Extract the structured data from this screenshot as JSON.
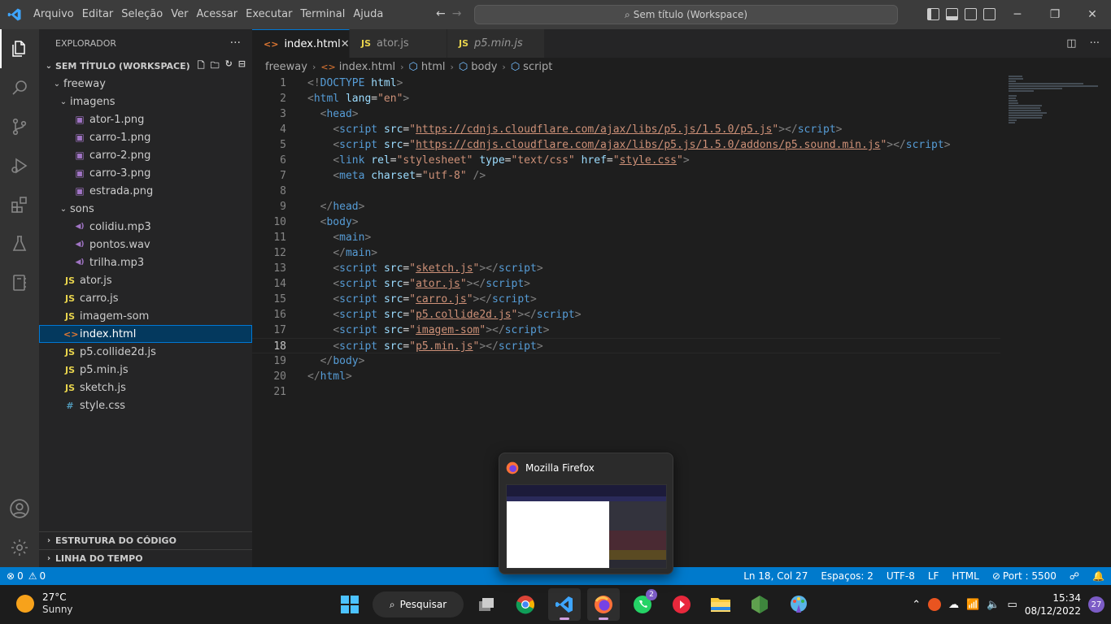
{
  "menu": [
    "Arquivo",
    "Editar",
    "Seleção",
    "Ver",
    "Acessar",
    "Executar",
    "Terminal",
    "Ajuda"
  ],
  "command_center": "Sem título (Workspace)",
  "explorer": {
    "title": "EXPLORADOR",
    "workspace": "SEM TÍTULO (WORKSPACE)",
    "tree": [
      {
        "label": "freeway",
        "type": "folder",
        "depth": 0
      },
      {
        "label": "imagens",
        "type": "folder",
        "depth": 1
      },
      {
        "label": "ator-1.png",
        "type": "img",
        "depth": 2
      },
      {
        "label": "carro-1.png",
        "type": "img",
        "depth": 2
      },
      {
        "label": "carro-2.png",
        "type": "img",
        "depth": 2
      },
      {
        "label": "carro-3.png",
        "type": "img",
        "depth": 2
      },
      {
        "label": "estrada.png",
        "type": "img",
        "depth": 2
      },
      {
        "label": "sons",
        "type": "folder",
        "depth": 1
      },
      {
        "label": "colidiu.mp3",
        "type": "snd",
        "depth": 2
      },
      {
        "label": "pontos.wav",
        "type": "snd",
        "depth": 2
      },
      {
        "label": "trilha.mp3",
        "type": "snd",
        "depth": 2
      },
      {
        "label": "ator.js",
        "type": "js",
        "depth": 1
      },
      {
        "label": "carro.js",
        "type": "js",
        "depth": 1
      },
      {
        "label": "imagem-som",
        "type": "js",
        "depth": 1
      },
      {
        "label": "index.html",
        "type": "html",
        "depth": 1,
        "selected": true
      },
      {
        "label": "p5.collide2d.js",
        "type": "js",
        "depth": 1
      },
      {
        "label": "p5.min.js",
        "type": "js",
        "depth": 1
      },
      {
        "label": "sketch.js",
        "type": "js",
        "depth": 1
      },
      {
        "label": "style.css",
        "type": "css",
        "depth": 1
      }
    ],
    "outline": "ESTRUTURA DO CÓDIGO",
    "timeline": "LINHA DO TEMPO"
  },
  "tabs": [
    {
      "label": "index.html",
      "type": "html",
      "active": true
    },
    {
      "label": "ator.js",
      "type": "js"
    },
    {
      "label": "p5.min.js",
      "type": "js",
      "italic": true
    }
  ],
  "breadcrumb": [
    "freeway",
    "index.html",
    "html",
    "body",
    "script"
  ],
  "code": [
    [
      [
        "br",
        "<!"
      ],
      [
        "tg",
        "DOCTYPE"
      ],
      [
        "tx",
        " "
      ],
      [
        "at",
        "html"
      ],
      [
        "br",
        ">"
      ]
    ],
    [
      [
        "br",
        "<"
      ],
      [
        "tg",
        "html"
      ],
      [
        "tx",
        " "
      ],
      [
        "at",
        "lang"
      ],
      [
        "tx",
        "="
      ],
      [
        "st",
        "\"en\""
      ],
      [
        "br",
        ">"
      ]
    ],
    [
      [
        "tx",
        "  "
      ],
      [
        "br",
        "<"
      ],
      [
        "tg",
        "head"
      ],
      [
        "br",
        ">"
      ]
    ],
    [
      [
        "tx",
        "    "
      ],
      [
        "br",
        "<"
      ],
      [
        "tg",
        "script"
      ],
      [
        "tx",
        " "
      ],
      [
        "at",
        "src"
      ],
      [
        "tx",
        "="
      ],
      [
        "st",
        "\""
      ],
      [
        "stu",
        "https://cdnjs.cloudflare.com/ajax/libs/p5.js/1.5.0/p5.js"
      ],
      [
        "st",
        "\""
      ],
      [
        "br",
        "></"
      ],
      [
        "tg",
        "script"
      ],
      [
        "br",
        ">"
      ]
    ],
    [
      [
        "tx",
        "    "
      ],
      [
        "br",
        "<"
      ],
      [
        "tg",
        "script"
      ],
      [
        "tx",
        " "
      ],
      [
        "at",
        "src"
      ],
      [
        "tx",
        "="
      ],
      [
        "st",
        "\""
      ],
      [
        "stu",
        "https://cdnjs.cloudflare.com/ajax/libs/p5.js/1.5.0/addons/p5.sound.min.js"
      ],
      [
        "st",
        "\""
      ],
      [
        "br",
        "></"
      ],
      [
        "tg",
        "script"
      ],
      [
        "br",
        ">"
      ]
    ],
    [
      [
        "tx",
        "    "
      ],
      [
        "br",
        "<"
      ],
      [
        "tg",
        "link"
      ],
      [
        "tx",
        " "
      ],
      [
        "at",
        "rel"
      ],
      [
        "tx",
        "="
      ],
      [
        "st",
        "\"stylesheet\""
      ],
      [
        "tx",
        " "
      ],
      [
        "at",
        "type"
      ],
      [
        "tx",
        "="
      ],
      [
        "st",
        "\"text/css\""
      ],
      [
        "tx",
        " "
      ],
      [
        "at",
        "href"
      ],
      [
        "tx",
        "="
      ],
      [
        "st",
        "\""
      ],
      [
        "stu",
        "style.css"
      ],
      [
        "st",
        "\""
      ],
      [
        "br",
        ">"
      ]
    ],
    [
      [
        "tx",
        "    "
      ],
      [
        "br",
        "<"
      ],
      [
        "tg",
        "meta"
      ],
      [
        "tx",
        " "
      ],
      [
        "at",
        "charset"
      ],
      [
        "tx",
        "="
      ],
      [
        "st",
        "\"utf-8\""
      ],
      [
        "tx",
        " "
      ],
      [
        "br",
        "/>"
      ]
    ],
    [
      [
        "tx",
        ""
      ]
    ],
    [
      [
        "tx",
        "  "
      ],
      [
        "br",
        "</"
      ],
      [
        "tg",
        "head"
      ],
      [
        "br",
        ">"
      ]
    ],
    [
      [
        "tx",
        "  "
      ],
      [
        "br",
        "<"
      ],
      [
        "tg",
        "body"
      ],
      [
        "br",
        ">"
      ]
    ],
    [
      [
        "tx",
        "    "
      ],
      [
        "br",
        "<"
      ],
      [
        "tg",
        "main"
      ],
      [
        "br",
        ">"
      ]
    ],
    [
      [
        "tx",
        "    "
      ],
      [
        "br",
        "</"
      ],
      [
        "tg",
        "main"
      ],
      [
        "br",
        ">"
      ]
    ],
    [
      [
        "tx",
        "    "
      ],
      [
        "br",
        "<"
      ],
      [
        "tg",
        "script"
      ],
      [
        "tx",
        " "
      ],
      [
        "at",
        "src"
      ],
      [
        "tx",
        "="
      ],
      [
        "st",
        "\""
      ],
      [
        "stu",
        "sketch.js"
      ],
      [
        "st",
        "\""
      ],
      [
        "br",
        "></"
      ],
      [
        "tg",
        "script"
      ],
      [
        "br",
        ">"
      ]
    ],
    [
      [
        "tx",
        "    "
      ],
      [
        "br",
        "<"
      ],
      [
        "tg",
        "script"
      ],
      [
        "tx",
        " "
      ],
      [
        "at",
        "src"
      ],
      [
        "tx",
        "="
      ],
      [
        "st",
        "\""
      ],
      [
        "stu",
        "ator.js"
      ],
      [
        "st",
        "\""
      ],
      [
        "br",
        "></"
      ],
      [
        "tg",
        "script"
      ],
      [
        "br",
        ">"
      ]
    ],
    [
      [
        "tx",
        "    "
      ],
      [
        "br",
        "<"
      ],
      [
        "tg",
        "script"
      ],
      [
        "tx",
        " "
      ],
      [
        "at",
        "src"
      ],
      [
        "tx",
        "="
      ],
      [
        "st",
        "\""
      ],
      [
        "stu",
        "carro.js"
      ],
      [
        "st",
        "\""
      ],
      [
        "br",
        "></"
      ],
      [
        "tg",
        "script"
      ],
      [
        "br",
        ">"
      ]
    ],
    [
      [
        "tx",
        "    "
      ],
      [
        "br",
        "<"
      ],
      [
        "tg",
        "script"
      ],
      [
        "tx",
        " "
      ],
      [
        "at",
        "src"
      ],
      [
        "tx",
        "="
      ],
      [
        "st",
        "\""
      ],
      [
        "stu",
        "p5.collide2d.js"
      ],
      [
        "st",
        "\""
      ],
      [
        "br",
        "></"
      ],
      [
        "tg",
        "script"
      ],
      [
        "br",
        ">"
      ]
    ],
    [
      [
        "tx",
        "    "
      ],
      [
        "br",
        "<"
      ],
      [
        "tg",
        "script"
      ],
      [
        "tx",
        " "
      ],
      [
        "at",
        "src"
      ],
      [
        "tx",
        "="
      ],
      [
        "st",
        "\""
      ],
      [
        "stu",
        "imagem-som"
      ],
      [
        "st",
        "\""
      ],
      [
        "br",
        "></"
      ],
      [
        "tg",
        "script"
      ],
      [
        "br",
        ">"
      ]
    ],
    [
      [
        "tx",
        "    "
      ],
      [
        "br",
        "<"
      ],
      [
        "tg",
        "script"
      ],
      [
        "tx",
        " "
      ],
      [
        "at",
        "src"
      ],
      [
        "tx",
        "="
      ],
      [
        "st",
        "\""
      ],
      [
        "stu",
        "p5.min.js"
      ],
      [
        "st",
        "\""
      ],
      [
        "br",
        "></"
      ],
      [
        "tg",
        "script"
      ],
      [
        "br",
        ">"
      ]
    ],
    [
      [
        "tx",
        "  "
      ],
      [
        "br",
        "</"
      ],
      [
        "tg",
        "body"
      ],
      [
        "br",
        ">"
      ]
    ],
    [
      [
        "br",
        "</"
      ],
      [
        "tg",
        "html"
      ],
      [
        "br",
        ">"
      ]
    ],
    [
      [
        "tx",
        ""
      ]
    ]
  ],
  "current_line": 18,
  "status": {
    "errors": "0",
    "warnings": "0",
    "position": "Ln 18, Col 27",
    "spaces": "Espaços: 2",
    "encoding": "UTF-8",
    "eol": "LF",
    "language": "HTML",
    "port": "Port : 5500"
  },
  "popup": {
    "title": "Mozilla Firefox"
  },
  "taskbar": {
    "temp": "27°C",
    "condition": "Sunny",
    "search": "Pesquisar",
    "whatsapp_badge": "2",
    "time": "15:34",
    "date": "08/12/2022",
    "notifications": "27"
  },
  "colors": {
    "accent": "#007acc",
    "selection": "#04395e"
  }
}
